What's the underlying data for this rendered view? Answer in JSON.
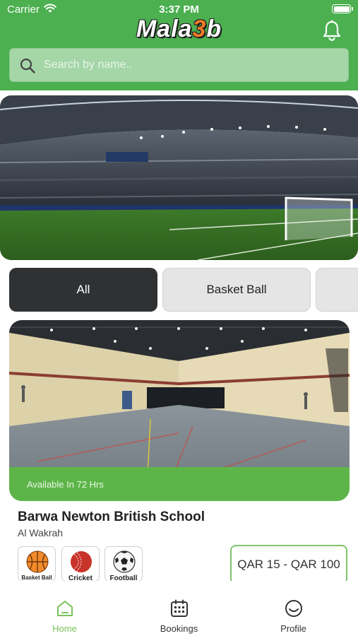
{
  "status_bar": {
    "carrier": "Carrier",
    "time": "3:37 PM"
  },
  "header": {
    "logo_text_start": "Mala",
    "logo_text_highlight": "3",
    "logo_text_end": "b",
    "bell_icon": "bell-icon"
  },
  "search": {
    "placeholder": "Search by name..",
    "value": "",
    "icon": "search-icon"
  },
  "filters": {
    "items": [
      {
        "label": "All",
        "selected": true
      },
      {
        "label": "Basket Ball",
        "selected": false
      },
      {
        "label": "",
        "selected": false
      }
    ]
  },
  "venue": {
    "availability": "Available In 72 Hrs",
    "name": "Barwa Newton British School",
    "location": "Al Wakrah",
    "sports": [
      {
        "label": "Basket Ball",
        "icon": "basketball-icon"
      },
      {
        "label": "Cricket",
        "icon": "cricket-ball-icon"
      },
      {
        "label": "Football",
        "icon": "football-icon"
      }
    ],
    "price": "QAR 15 - QAR 100"
  },
  "tabbar": {
    "tabs": [
      {
        "label": "Home",
        "icon": "home-icon",
        "active": true
      },
      {
        "label": "Bookings",
        "icon": "calendar-icon",
        "active": false
      },
      {
        "label": "Profile",
        "icon": "profile-icon",
        "active": false
      }
    ]
  },
  "colors": {
    "brand_green": "#4caf50",
    "logo_accent": "#f07a2a",
    "active_tab": "#7ac25a",
    "chip_selected": "#2f3133"
  }
}
